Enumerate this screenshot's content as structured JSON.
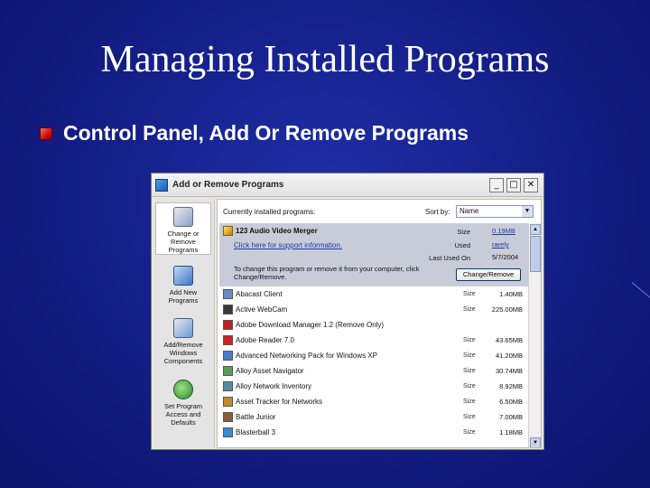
{
  "slide": {
    "title": "Managing Installed Programs",
    "bullet": "Control Panel, Add Or Remove Programs"
  },
  "window": {
    "title": "Add or Remove Programs",
    "minimize": "_",
    "maximize": "□",
    "close": "✕"
  },
  "sidebar": {
    "items": [
      {
        "label": "Change or Remove Programs",
        "icon": "change-remove-icon"
      },
      {
        "label": "Add New Programs",
        "icon": "add-new-icon"
      },
      {
        "label": "Add/Remove Windows Components",
        "icon": "windows-components-icon"
      },
      {
        "label": "Set Program Access and Defaults",
        "icon": "program-access-icon"
      }
    ]
  },
  "main": {
    "currently_installed": "Currently installed programs:",
    "sort_by_label": "Sort by:",
    "sort_by_value": "Name",
    "selected": {
      "name": "123 Audio Video Merger",
      "support_link": "Click here for support information.",
      "size_label": "Size",
      "size": "0.19MB",
      "used_label": "Used",
      "used": "rarely",
      "last_used_label": "Last Used On",
      "last_used": "5/7/2004",
      "description": "To change this program or remove it from your computer, click Change/Remove.",
      "button": "Change/Remove"
    },
    "size_label": "Size",
    "programs": [
      {
        "name": "Abacast Client",
        "size": "1.40MB",
        "color": "#6a8ac8"
      },
      {
        "name": "Active WebCam",
        "size": "225.00MB",
        "color": "#3a3a3a"
      },
      {
        "name": "Adobe Download Manager 1.2 (Remove Only)",
        "size": "",
        "color": "#c02020"
      },
      {
        "name": "Adobe Reader 7.0",
        "size": "43.65MB",
        "color": "#d02020"
      },
      {
        "name": "Advanced Networking Pack for Windows XP",
        "size": "41.20MB",
        "color": "#4a7ac8"
      },
      {
        "name": "Alloy Asset Navigator",
        "size": "30.74MB",
        "color": "#5a9a5a"
      },
      {
        "name": "Alloy Network Inventory",
        "size": "8.92MB",
        "color": "#5a8aa8"
      },
      {
        "name": "Asset Tracker for Networks",
        "size": "6.50MB",
        "color": "#c08a2a"
      },
      {
        "name": "Battle Junior",
        "size": "7.00MB",
        "color": "#8a5a3a"
      },
      {
        "name": "Blasterball 3",
        "size": "1.18MB",
        "color": "#3a8ad8"
      }
    ]
  },
  "colors": {
    "background": "#15208a",
    "selected_row": "#c8ccd8",
    "link": "#1a3aa8"
  }
}
